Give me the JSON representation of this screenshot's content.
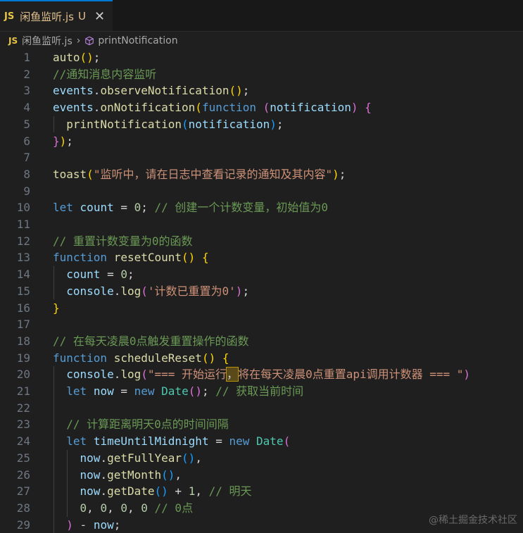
{
  "tab": {
    "badge": "JS",
    "title": "闲鱼监听.js",
    "modified": "U",
    "close": "✕"
  },
  "breadcrumb": {
    "file_badge": "JS",
    "file": "闲鱼监听.js",
    "separator": "›",
    "symbol": "printNotification"
  },
  "watermark": "@稀土掘金技术社区",
  "colors": {
    "accent": "#0078d4",
    "background": "#1f1f1f",
    "function": "#dcdcaa",
    "keyword": "#569cd6",
    "string": "#ce9178",
    "comment": "#6a9955",
    "number": "#b5cea8"
  },
  "lines": [
    {
      "n": "1",
      "tokens": [
        [
          "fn",
          "auto"
        ],
        [
          "p1",
          "()"
        ],
        [
          "op",
          ";"
        ]
      ]
    },
    {
      "n": "2",
      "tokens": [
        [
          "cmt",
          "//通知消息内容监听"
        ]
      ]
    },
    {
      "n": "3",
      "tokens": [
        [
          "var",
          "events"
        ],
        [
          "op",
          "."
        ],
        [
          "fn",
          "observeNotification"
        ],
        [
          "p1",
          "()"
        ],
        [
          "op",
          ";"
        ]
      ]
    },
    {
      "n": "4",
      "tokens": [
        [
          "var",
          "events"
        ],
        [
          "op",
          "."
        ],
        [
          "fn",
          "onNotification"
        ],
        [
          "p1",
          "("
        ],
        [
          "kw",
          "function"
        ],
        [
          "op",
          " "
        ],
        [
          "p2",
          "("
        ],
        [
          "var",
          "notification"
        ],
        [
          "p2",
          ")"
        ],
        [
          "op",
          " "
        ],
        [
          "p2",
          "{"
        ]
      ]
    },
    {
      "n": "5",
      "tokens": [
        [
          "op",
          "  "
        ],
        [
          "fn",
          "printNotification"
        ],
        [
          "p3",
          "("
        ],
        [
          "var",
          "notification"
        ],
        [
          "p3",
          ")"
        ],
        [
          "op",
          ";"
        ]
      ]
    },
    {
      "n": "6",
      "tokens": [
        [
          "p2",
          "}"
        ],
        [
          "p1",
          ")"
        ],
        [
          "op",
          ";"
        ]
      ]
    },
    {
      "n": "7",
      "tokens": []
    },
    {
      "n": "8",
      "tokens": [
        [
          "fn",
          "toast"
        ],
        [
          "p1",
          "("
        ],
        [
          "str",
          "\"监听中，请在日志中查看记录的通知及其内容\""
        ],
        [
          "p1",
          ")"
        ],
        [
          "op",
          ";"
        ]
      ]
    },
    {
      "n": "9",
      "tokens": []
    },
    {
      "n": "10",
      "tokens": [
        [
          "kw",
          "let"
        ],
        [
          "op",
          " "
        ],
        [
          "var",
          "count"
        ],
        [
          "op",
          " = "
        ],
        [
          "num",
          "0"
        ],
        [
          "op",
          "; "
        ],
        [
          "cmt",
          "// 创建一个计数变量，初始值为0"
        ]
      ]
    },
    {
      "n": "11",
      "tokens": []
    },
    {
      "n": "12",
      "tokens": [
        [
          "cmt",
          "// 重置计数变量为0的函数"
        ]
      ]
    },
    {
      "n": "13",
      "tokens": [
        [
          "kw",
          "function"
        ],
        [
          "op",
          " "
        ],
        [
          "fn",
          "resetCount"
        ],
        [
          "p1",
          "()"
        ],
        [
          "op",
          " "
        ],
        [
          "p1",
          "{"
        ]
      ]
    },
    {
      "n": "14",
      "tokens": [
        [
          "op",
          "  "
        ],
        [
          "var",
          "count"
        ],
        [
          "op",
          " = "
        ],
        [
          "num",
          "0"
        ],
        [
          "op",
          ";"
        ]
      ]
    },
    {
      "n": "15",
      "tokens": [
        [
          "op",
          "  "
        ],
        [
          "var",
          "console"
        ],
        [
          "op",
          "."
        ],
        [
          "fn",
          "log"
        ],
        [
          "p2",
          "("
        ],
        [
          "str",
          "'计数已重置为0'"
        ],
        [
          "p2",
          ")"
        ],
        [
          "op",
          ";"
        ]
      ]
    },
    {
      "n": "16",
      "tokens": [
        [
          "p1",
          "}"
        ]
      ]
    },
    {
      "n": "17",
      "tokens": []
    },
    {
      "n": "18",
      "tokens": [
        [
          "cmt",
          "// 在每天凌晨0点触发重置操作的函数"
        ]
      ]
    },
    {
      "n": "19",
      "tokens": [
        [
          "kw",
          "function"
        ],
        [
          "op",
          " "
        ],
        [
          "fn",
          "scheduleReset"
        ],
        [
          "p1",
          "()"
        ],
        [
          "op",
          " "
        ],
        [
          "p1",
          "{"
        ]
      ]
    },
    {
      "n": "20",
      "tokens": [
        [
          "op",
          "  "
        ],
        [
          "var",
          "console"
        ],
        [
          "op",
          "."
        ],
        [
          "fn",
          "log"
        ],
        [
          "p2",
          "("
        ],
        [
          "str",
          "\"=== 开始运行"
        ],
        [
          "hl",
          "，"
        ],
        [
          "str",
          "将在每天凌晨0点重置api调用计数器 === \""
        ],
        [
          "p2",
          ")"
        ]
      ]
    },
    {
      "n": "21",
      "tokens": [
        [
          "op",
          "  "
        ],
        [
          "kw",
          "let"
        ],
        [
          "op",
          " "
        ],
        [
          "var",
          "now"
        ],
        [
          "op",
          " = "
        ],
        [
          "kw",
          "new"
        ],
        [
          "op",
          " "
        ],
        [
          "cls",
          "Date"
        ],
        [
          "p2",
          "()"
        ],
        [
          "op",
          "; "
        ],
        [
          "cmt",
          "// 获取当前时间"
        ]
      ]
    },
    {
      "n": "22",
      "tokens": []
    },
    {
      "n": "23",
      "tokens": [
        [
          "op",
          "  "
        ],
        [
          "cmt",
          "// 计算距离明天0点的时间间隔"
        ]
      ]
    },
    {
      "n": "24",
      "tokens": [
        [
          "op",
          "  "
        ],
        [
          "kw",
          "let"
        ],
        [
          "op",
          " "
        ],
        [
          "var",
          "timeUntilMidnight"
        ],
        [
          "op",
          " = "
        ],
        [
          "kw",
          "new"
        ],
        [
          "op",
          " "
        ],
        [
          "cls",
          "Date"
        ],
        [
          "p2",
          "("
        ]
      ]
    },
    {
      "n": "25",
      "tokens": [
        [
          "op",
          "    "
        ],
        [
          "var",
          "now"
        ],
        [
          "op",
          "."
        ],
        [
          "fn",
          "getFullYear"
        ],
        [
          "p3",
          "()"
        ],
        [
          "op",
          ","
        ]
      ]
    },
    {
      "n": "26",
      "tokens": [
        [
          "op",
          "    "
        ],
        [
          "var",
          "now"
        ],
        [
          "op",
          "."
        ],
        [
          "fn",
          "getMonth"
        ],
        [
          "p3",
          "()"
        ],
        [
          "op",
          ","
        ]
      ]
    },
    {
      "n": "27",
      "tokens": [
        [
          "op",
          "    "
        ],
        [
          "var",
          "now"
        ],
        [
          "op",
          "."
        ],
        [
          "fn",
          "getDate"
        ],
        [
          "p3",
          "()"
        ],
        [
          "op",
          " + "
        ],
        [
          "num",
          "1"
        ],
        [
          "op",
          ", "
        ],
        [
          "cmt",
          "// 明天"
        ]
      ]
    },
    {
      "n": "28",
      "tokens": [
        [
          "op",
          "    "
        ],
        [
          "num",
          "0"
        ],
        [
          "op",
          ", "
        ],
        [
          "num",
          "0"
        ],
        [
          "op",
          ", "
        ],
        [
          "num",
          "0"
        ],
        [
          "op",
          ", "
        ],
        [
          "num",
          "0"
        ],
        [
          "op",
          " "
        ],
        [
          "cmt",
          "// 0点"
        ]
      ]
    },
    {
      "n": "29",
      "tokens": [
        [
          "op",
          "  "
        ],
        [
          "p2",
          ")"
        ],
        [
          "op",
          " - "
        ],
        [
          "var",
          "now"
        ],
        [
          "op",
          ";"
        ]
      ]
    }
  ]
}
